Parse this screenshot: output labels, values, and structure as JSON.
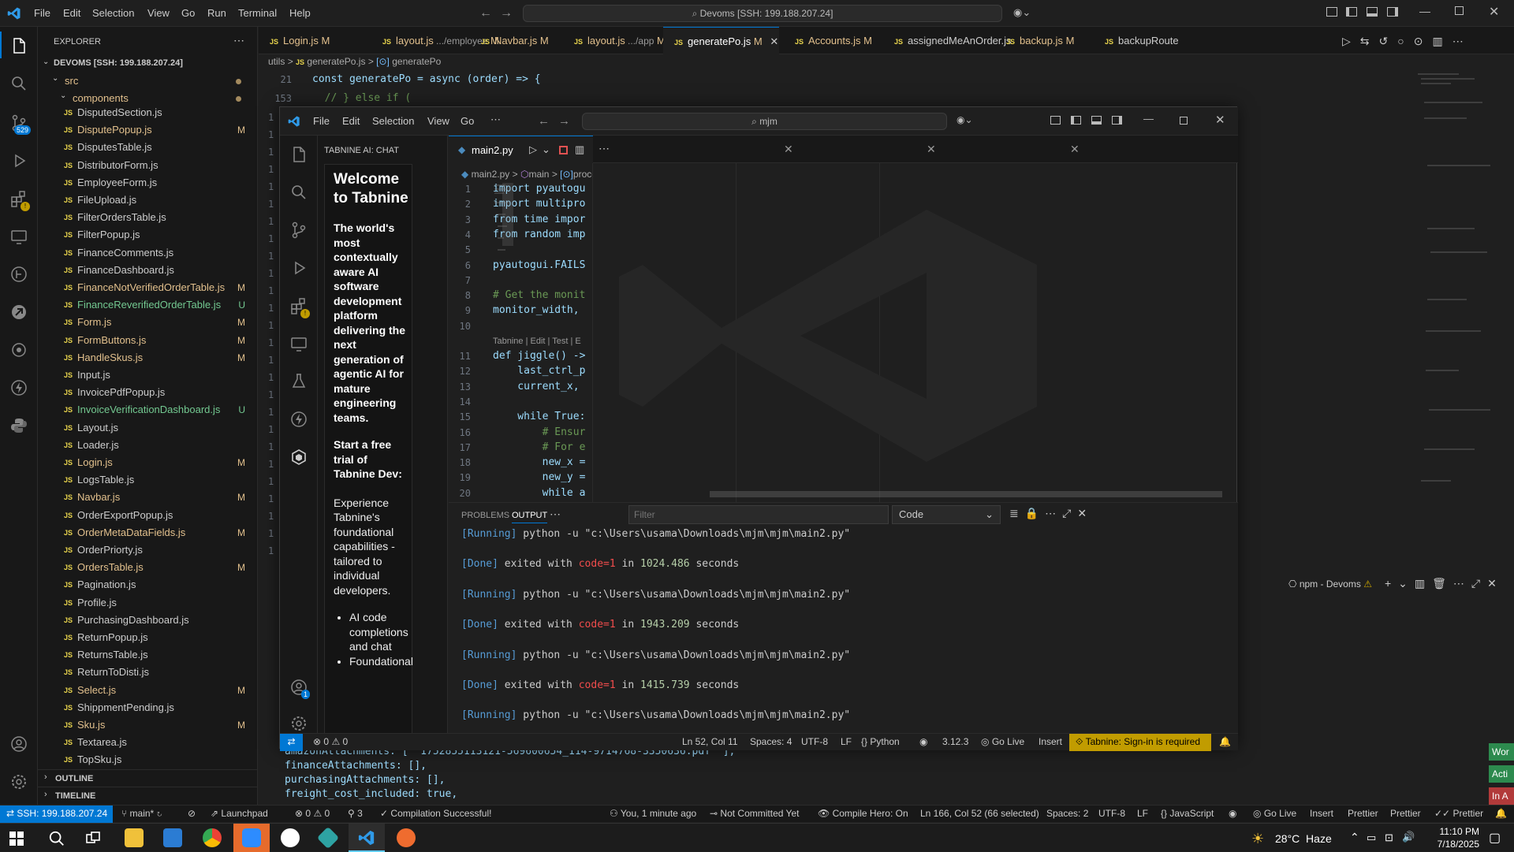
{
  "outer": {
    "menu": [
      "File",
      "Edit",
      "Selection",
      "View",
      "Go",
      "Run",
      "Terminal",
      "Help"
    ],
    "command_center": "Devoms [SSH: 199.188.207.24]",
    "explorer_title": "EXPLORER",
    "root": "DEVOMS [SSH: 199.188.207.24]",
    "src": "src",
    "components": "components",
    "scm_badge": "529",
    "files": [
      {
        "name": "DisputedSection.js",
        "status": ""
      },
      {
        "name": "DisputePopup.js",
        "status": "M"
      },
      {
        "name": "DisputesTable.js",
        "status": ""
      },
      {
        "name": "DistributorForm.js",
        "status": ""
      },
      {
        "name": "EmployeeForm.js",
        "status": ""
      },
      {
        "name": "FileUpload.js",
        "status": ""
      },
      {
        "name": "FilterOrdersTable.js",
        "status": ""
      },
      {
        "name": "FilterPopup.js",
        "status": ""
      },
      {
        "name": "FinanceComments.js",
        "status": ""
      },
      {
        "name": "FinanceDashboard.js",
        "status": ""
      },
      {
        "name": "FinanceNotVerifiedOrderTable.js",
        "status": "M"
      },
      {
        "name": "FinanceReverifiedOrderTable.js",
        "status": "U"
      },
      {
        "name": "Form.js",
        "status": "M"
      },
      {
        "name": "FormButtons.js",
        "status": "M"
      },
      {
        "name": "HandleSkus.js",
        "status": "M"
      },
      {
        "name": "Input.js",
        "status": ""
      },
      {
        "name": "InvoicePdfPopup.js",
        "status": ""
      },
      {
        "name": "InvoiceVerificationDashboard.js",
        "status": "U"
      },
      {
        "name": "Layout.js",
        "status": ""
      },
      {
        "name": "Loader.js",
        "status": ""
      },
      {
        "name": "Login.js",
        "status": "M"
      },
      {
        "name": "LogsTable.js",
        "status": ""
      },
      {
        "name": "Navbar.js",
        "status": "M"
      },
      {
        "name": "OrderExportPopup.js",
        "status": ""
      },
      {
        "name": "OrderMetaDataFields.js",
        "status": "M"
      },
      {
        "name": "OrderPriorty.js",
        "status": ""
      },
      {
        "name": "OrdersTable.js",
        "status": "M"
      },
      {
        "name": "Pagination.js",
        "status": ""
      },
      {
        "name": "Profile.js",
        "status": ""
      },
      {
        "name": "PurchasingDashboard.js",
        "status": ""
      },
      {
        "name": "ReturnPopup.js",
        "status": ""
      },
      {
        "name": "ReturnsTable.js",
        "status": ""
      },
      {
        "name": "ReturnToDisti.js",
        "status": ""
      },
      {
        "name": "Select.js",
        "status": "M"
      },
      {
        "name": "ShippmentPending.js",
        "status": ""
      },
      {
        "name": "Sku.js",
        "status": "M"
      },
      {
        "name": "Textarea.js",
        "status": ""
      },
      {
        "name": "TopSku.js",
        "status": ""
      }
    ],
    "outline": "OUTLINE",
    "timeline": "TIMELINE",
    "tabs": [
      {
        "label": "Login.js",
        "extra": "",
        "status": "M"
      },
      {
        "label": "layout.js",
        "extra": " .../employee",
        "status": "M"
      },
      {
        "label": "Navbar.js",
        "extra": "",
        "status": "M"
      },
      {
        "label": "layout.js",
        "extra": " .../app",
        "status": "M"
      },
      {
        "label": "generatePo.js",
        "extra": "",
        "status": "M"
      },
      {
        "label": "Accounts.js",
        "extra": "",
        "status": "M"
      },
      {
        "label": "assignedMeAnOrder.js",
        "extra": "",
        "status": ""
      },
      {
        "label": "backup.js",
        "extra": "",
        "status": "M"
      },
      {
        "label": "backupRoute",
        "extra": "",
        "status": ""
      }
    ],
    "breadcrumb": [
      "utils",
      ">",
      "generatePo.js",
      ">",
      "generatePo"
    ],
    "sticky1_no": "21",
    "sticky1": "const generatePo = async (order) => {",
    "sticky2_no": "153",
    "sticky2": "  // } else if (",
    "bottom_code": [
      "amazonAttachments: [ '1752855113121-569600654_114-9714768-3350636.pdf' ],",
      "financeAttachments: [],",
      "purchasingAttachments: [],",
      "freight_cost_included: true,"
    ],
    "terminal_label": "npm - Devoms",
    "status": {
      "ssh": "SSH: 199.188.207.24",
      "branch": "main*",
      "errors": "0",
      "warnings": "0",
      "ports": "3",
      "launchpad": "Launchpad",
      "compile": "Compilation Successful!",
      "blame": "You, 1 minute ago",
      "commit": "Not Committed Yet",
      "hero": "Compile Hero: On",
      "position": "Ln 166, Col 52 (66 selected)",
      "spaces": "Spaces: 2",
      "encoding": "UTF-8",
      "eol": "LF",
      "lang": "JavaScript",
      "golive": "Go Live",
      "insert": "Insert",
      "prettier1": "Prettier",
      "prettier2": "Prettier",
      "prettier3": "Prettier"
    },
    "right_badges": [
      "Wor",
      "Acti",
      "In A"
    ]
  },
  "inner": {
    "menu": [
      "File",
      "Edit",
      "Selection",
      "View",
      "Go"
    ],
    "search": "mjm",
    "panel_title": "TABNINE AI: CHAT",
    "welcome_title": "Welcome to Tabnine",
    "welcome_body": "The world's most contextually aware AI software development platform delivering the next generation of agentic AI for mature engineering teams.",
    "trial_title": "Start a free trial of Tabnine Dev:",
    "trial_body": "Experience Tabnine's foundational capabilities - tailored to individual developers.",
    "bullets": [
      "AI code completions and chat",
      "Foundational"
    ],
    "tab": "main2.py",
    "breadcrumb": [
      "main2.py",
      ">",
      "main",
      ">",
      "proce"
    ],
    "code": [
      {
        "n": "1",
        "t": "import pyautogu"
      },
      {
        "n": "2",
        "t": "import multipro"
      },
      {
        "n": "3",
        "t": "from time impor"
      },
      {
        "n": "4",
        "t": "from random imp"
      },
      {
        "n": "5",
        "t": ""
      },
      {
        "n": "6",
        "t": "pyautogui.FAILS"
      },
      {
        "n": "7",
        "t": ""
      },
      {
        "n": "8",
        "t": "# Get the monit"
      },
      {
        "n": "9",
        "t": "monitor_width, "
      },
      {
        "n": "10",
        "t": ""
      },
      {
        "n": "11",
        "t": "def jiggle() ->"
      },
      {
        "n": "12",
        "t": "    last_ctrl_p"
      },
      {
        "n": "13",
        "t": "    current_x, "
      },
      {
        "n": "14",
        "t": ""
      },
      {
        "n": "15",
        "t": "    while True:"
      },
      {
        "n": "16",
        "t": "        # Ensur"
      },
      {
        "n": "17",
        "t": "        # For e"
      },
      {
        "n": "18",
        "t": "        new_x ="
      },
      {
        "n": "19",
        "t": "        new_y ="
      },
      {
        "n": "20",
        "t": "        while a"
      }
    ],
    "codelens": "Tabnine | Edit | Test | E",
    "panel_tabs": [
      "PROBLEMS",
      "OUTPUT"
    ],
    "filter_placeholder": "Filter",
    "channel": "Code",
    "output": [
      {
        "tag": "[Running]",
        "text": " python -u \"c:\\Users\\usama\\Downloads\\mjm\\mjm\\main2.py\""
      },
      {
        "tag": "[Done]",
        "text": " exited with ",
        "code": "code=1",
        "in": " in ",
        "num": "1024.486",
        "sec": " seconds"
      },
      {
        "tag": "[Running]",
        "text": " python -u \"c:\\Users\\usama\\Downloads\\mjm\\mjm\\main2.py\""
      },
      {
        "tag": "[Done]",
        "text": " exited with ",
        "code": "code=1",
        "in": " in ",
        "num": "1943.209",
        "sec": " seconds"
      },
      {
        "tag": "[Running]",
        "text": " python -u \"c:\\Users\\usama\\Downloads\\mjm\\mjm\\main2.py\""
      },
      {
        "tag": "[Done]",
        "text": " exited with ",
        "code": "code=1",
        "in": " in ",
        "num": "1415.739",
        "sec": " seconds"
      },
      {
        "tag": "[Running]",
        "text": " python -u \"c:\\Users\\usama\\Downloads\\mjm\\mjm\\main2.py\""
      }
    ],
    "status": {
      "errors": "0",
      "warnings": "0",
      "position": "Ln 52, Col 11",
      "spaces": "Spaces: 4",
      "encoding": "UTF-8",
      "eol": "LF",
      "lang": "Python",
      "version": "3.12.3",
      "golive": "Go Live",
      "insert": "Insert",
      "tabnine": "Tabnine: Sign-in is required"
    },
    "account_badge": "1"
  },
  "taskbar": {
    "weather": "28°C  Haze",
    "time": "11:10 PM",
    "date": "7/18/2025"
  },
  "colors": {
    "accent": "#0078d4",
    "statusRemote": "#0078d4",
    "tabnineWarn": "#c19c00"
  }
}
